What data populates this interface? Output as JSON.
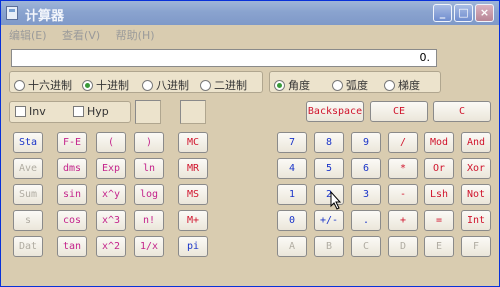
{
  "window": {
    "title": "计算器"
  },
  "titlebar_buttons": {
    "minimize": "_",
    "maximize": "□",
    "close": "×"
  },
  "menu": [
    "编辑(E)",
    "查看(V)",
    "帮助(H)"
  ],
  "display": {
    "value": "0."
  },
  "base_radios": [
    {
      "label": "十六进制",
      "selected": false
    },
    {
      "label": "十进制",
      "selected": true
    },
    {
      "label": "八进制",
      "selected": false
    },
    {
      "label": "二进制",
      "selected": false
    }
  ],
  "angle_radios": [
    {
      "label": "角度",
      "selected": true
    },
    {
      "label": "弧度",
      "selected": false
    },
    {
      "label": "梯度",
      "selected": false
    }
  ],
  "checkboxes": [
    {
      "label": "Inv"
    },
    {
      "label": "Hyp"
    }
  ],
  "edit_buttons": [
    "Backspace",
    "CE",
    "C"
  ],
  "stat_buttons": [
    "Sta",
    "Ave",
    "Sum",
    "s",
    "Dat"
  ],
  "sci_col1": [
    "F-E",
    "dms",
    "sin",
    "cos",
    "tan"
  ],
  "sci_col2": [
    "(",
    "Exp",
    "x^y",
    "x^3",
    "x^2"
  ],
  "sci_col3": [
    ")",
    "ln",
    "log",
    "n!",
    "1/x"
  ],
  "mem_buttons": [
    "MC",
    "MR",
    "MS",
    "M+",
    "pi"
  ],
  "num_rows": [
    [
      "7",
      "8",
      "9",
      "/",
      "Mod",
      "And"
    ],
    [
      "4",
      "5",
      "6",
      "*",
      "Or",
      "Xor"
    ],
    [
      "1",
      "2",
      "3",
      "-",
      "Lsh",
      "Not"
    ],
    [
      "0",
      "+/-",
      ".",
      "+",
      "=",
      "Int"
    ],
    [
      "A",
      "B",
      "C",
      "D",
      "E",
      "F"
    ]
  ]
}
